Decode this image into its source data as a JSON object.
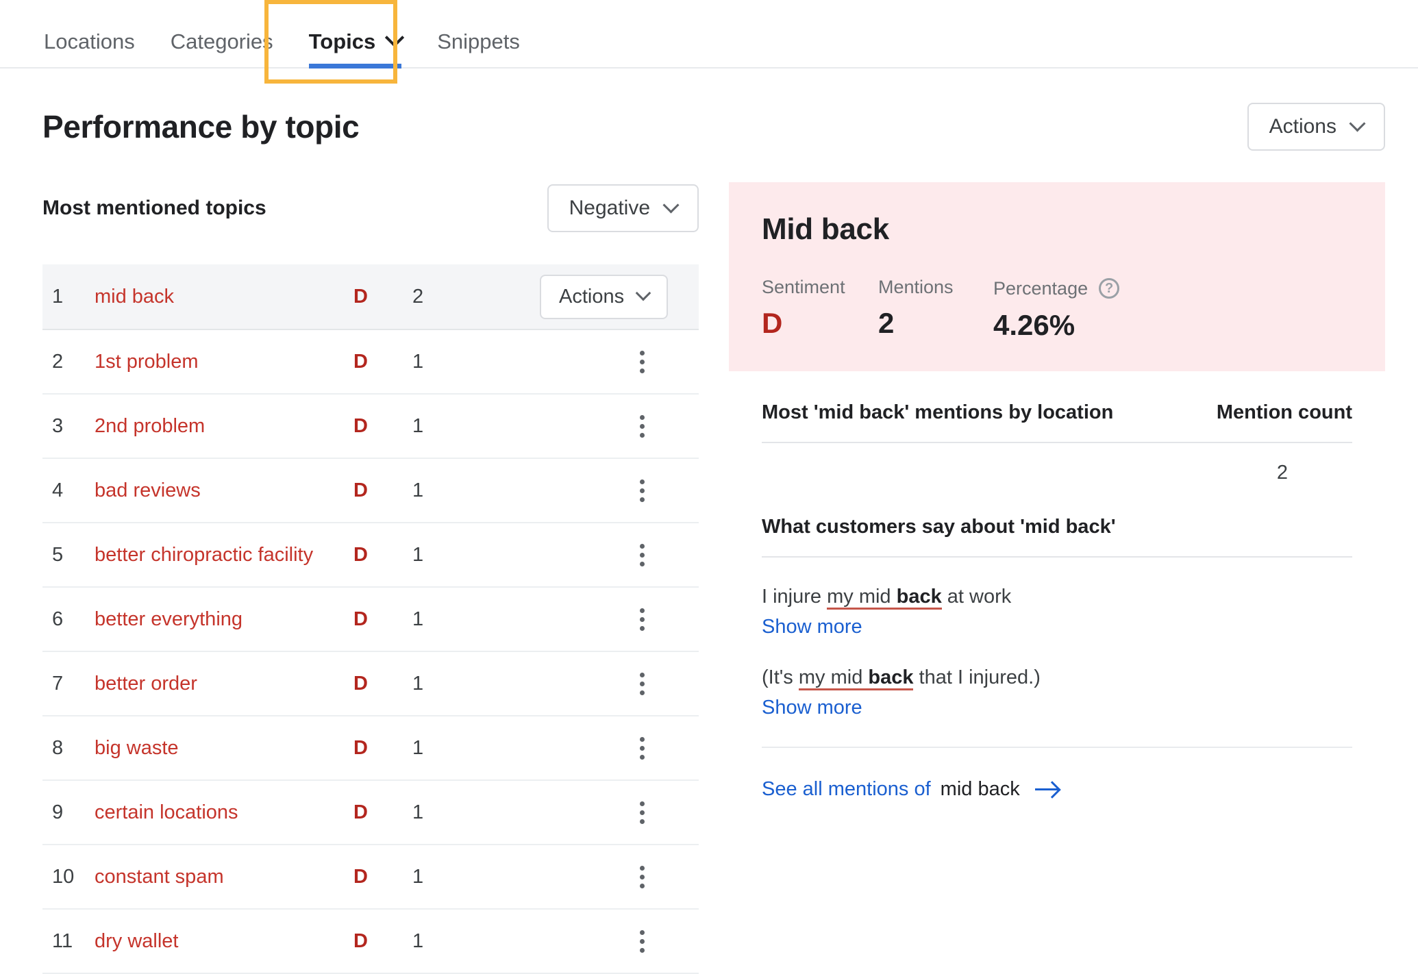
{
  "tabs": [
    {
      "label": "Locations",
      "active": false,
      "has_chevron": false
    },
    {
      "label": "Categories",
      "active": false,
      "has_chevron": false
    },
    {
      "label": "Topics",
      "active": true,
      "has_chevron": true
    },
    {
      "label": "Snippets",
      "active": false,
      "has_chevron": false
    }
  ],
  "page": {
    "title": "Performance by topic",
    "actions_label": "Actions"
  },
  "left_panel": {
    "section_title": "Most mentioned topics",
    "sentiment_filter": "Negative",
    "row_actions_label": "Actions",
    "rows": [
      {
        "rank": "1",
        "name": "mid back",
        "sentiment": "D",
        "count": "2",
        "selected": true
      },
      {
        "rank": "2",
        "name": "1st problem",
        "sentiment": "D",
        "count": "1",
        "selected": false
      },
      {
        "rank": "3",
        "name": "2nd problem",
        "sentiment": "D",
        "count": "1",
        "selected": false
      },
      {
        "rank": "4",
        "name": "bad reviews",
        "sentiment": "D",
        "count": "1",
        "selected": false
      },
      {
        "rank": "5",
        "name": "better chiropractic facility",
        "sentiment": "D",
        "count": "1",
        "selected": false
      },
      {
        "rank": "6",
        "name": "better everything",
        "sentiment": "D",
        "count": "1",
        "selected": false
      },
      {
        "rank": "7",
        "name": "better order",
        "sentiment": "D",
        "count": "1",
        "selected": false
      },
      {
        "rank": "8",
        "name": "big waste",
        "sentiment": "D",
        "count": "1",
        "selected": false
      },
      {
        "rank": "9",
        "name": "certain locations",
        "sentiment": "D",
        "count": "1",
        "selected": false
      },
      {
        "rank": "10",
        "name": "constant spam",
        "sentiment": "D",
        "count": "1",
        "selected": false
      },
      {
        "rank": "11",
        "name": "dry wallet",
        "sentiment": "D",
        "count": "1",
        "selected": false
      }
    ]
  },
  "right_panel": {
    "title": "Mid back",
    "stats": {
      "sentiment_label": "Sentiment",
      "sentiment_value": "D",
      "mentions_label": "Mentions",
      "mentions_value": "2",
      "percentage_label": "Percentage",
      "percentage_value": "4.26%"
    },
    "locations": {
      "header_left": "Most 'mid back' mentions by location",
      "header_right": "Mention count",
      "rows": [
        {
          "location": "",
          "count": "2"
        }
      ]
    },
    "quotes": {
      "header": "What customers say about 'mid back'",
      "show_more_label": "Show more",
      "items": [
        {
          "pre": "I injure ",
          "hl_pre": "my mid ",
          "hl_bold": "back",
          "post": " at work"
        },
        {
          "pre": "(It's ",
          "hl_pre": "my mid ",
          "hl_bold": "back",
          "post": " that I injured.)"
        }
      ]
    },
    "see_all": {
      "link_text": "See all mentions of",
      "topic_text": "mid back"
    }
  },
  "colors": {
    "accent_blue": "#3b78d8",
    "link_blue": "#1a5fd0",
    "negative_red": "#c5342b",
    "sentiment_red": "#b3261e",
    "annotation_orange": "#f7b53c",
    "pink_card": "#fdeaec"
  }
}
